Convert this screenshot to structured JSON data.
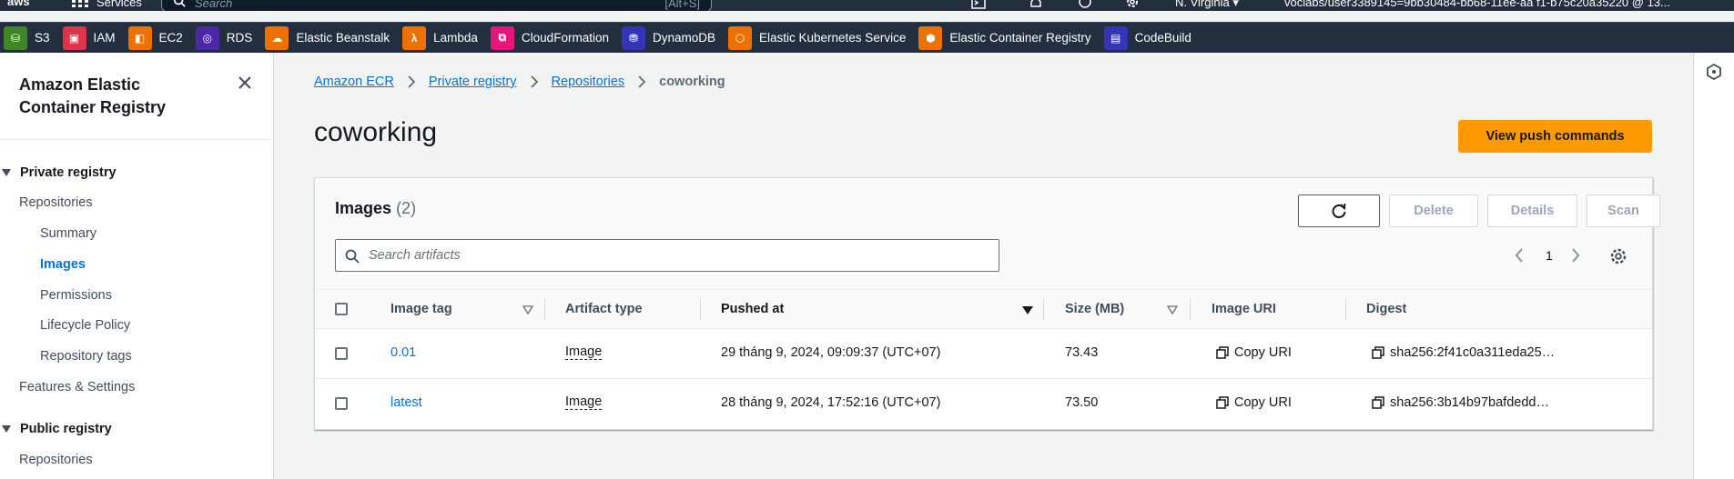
{
  "topnav": {
    "logo": "aws",
    "services_label": "Services",
    "search_placeholder": "Search",
    "search_shortcut": "[Alt+S]",
    "region": "N. Virginia ▾",
    "account": "voclabs/user3389145=9bb30484-bb68-11ee-aa f1-b75c20a35220 @ 13..."
  },
  "favorites": [
    {
      "label": "S3",
      "icon": "s3-icon",
      "color": "#3f8624",
      "glyph": "⛁"
    },
    {
      "label": "IAM",
      "icon": "iam-icon",
      "color": "#dd344c",
      "glyph": "▣"
    },
    {
      "label": "EC2",
      "icon": "ec2-icon",
      "color": "#ed7100",
      "glyph": "◧"
    },
    {
      "label": "RDS",
      "icon": "rds-icon",
      "color": "#4d27aa",
      "glyph": "◎"
    },
    {
      "label": "Elastic Beanstalk",
      "icon": "beanstalk-icon",
      "color": "#ed7100",
      "glyph": "☁"
    },
    {
      "label": "Lambda",
      "icon": "lambda-icon",
      "color": "#ed7100",
      "glyph": "λ"
    },
    {
      "label": "CloudFormation",
      "icon": "cloudformation-icon",
      "color": "#e7157b",
      "glyph": "⧉"
    },
    {
      "label": "DynamoDB",
      "icon": "dynamodb-icon",
      "color": "#3334b9",
      "glyph": "⛃"
    },
    {
      "label": "Elastic Kubernetes Service",
      "icon": "eks-icon",
      "color": "#ed7100",
      "glyph": "⬡"
    },
    {
      "label": "Elastic Container Registry",
      "icon": "ecr-icon",
      "color": "#ed7100",
      "glyph": "⬢"
    },
    {
      "label": "CodeBuild",
      "icon": "codebuild-icon",
      "color": "#3334b9",
      "glyph": "▤"
    }
  ],
  "sidenav": {
    "title": "Amazon Elastic Container Registry",
    "private_registry": "Private registry",
    "private_items": [
      "Repositories",
      "Summary",
      "Images",
      "Permissions",
      "Lifecycle Policy",
      "Repository tags",
      "Features & Settings"
    ],
    "public_registry": "Public registry",
    "public_items": [
      "Repositories"
    ]
  },
  "breadcrumb": {
    "items": [
      "Amazon ECR",
      "Private registry",
      "Repositories"
    ],
    "current": "coworking"
  },
  "page": {
    "title": "coworking",
    "primary_button": "View push commands"
  },
  "images_panel": {
    "title": "Images",
    "count": "(2)",
    "buttons": {
      "delete": "Delete",
      "details": "Details",
      "scan": "Scan"
    },
    "search_placeholder": "Search artifacts",
    "page_number": "1",
    "columns": [
      "Image tag",
      "Artifact type",
      "Pushed at",
      "Size (MB)",
      "Image URI",
      "Digest"
    ],
    "rows": [
      {
        "tag": "0.01",
        "artifact_type": "Image",
        "pushed_at": "29 tháng 9, 2024, 09:09:37 (UTC+07)",
        "size": "73.43",
        "uri": "Copy URI",
        "digest": "sha256:2f41c0a311eda25…"
      },
      {
        "tag": "latest",
        "artifact_type": "Image",
        "pushed_at": "28 tháng 9, 2024, 17:52:16 (UTC+07)",
        "size": "73.50",
        "uri": "Copy URI",
        "digest": "sha256:3b14b97bafdedd…"
      }
    ]
  },
  "colors": {
    "accent": "#ff9900",
    "link": "#0972d3",
    "nav_bg": "#232f3e"
  }
}
